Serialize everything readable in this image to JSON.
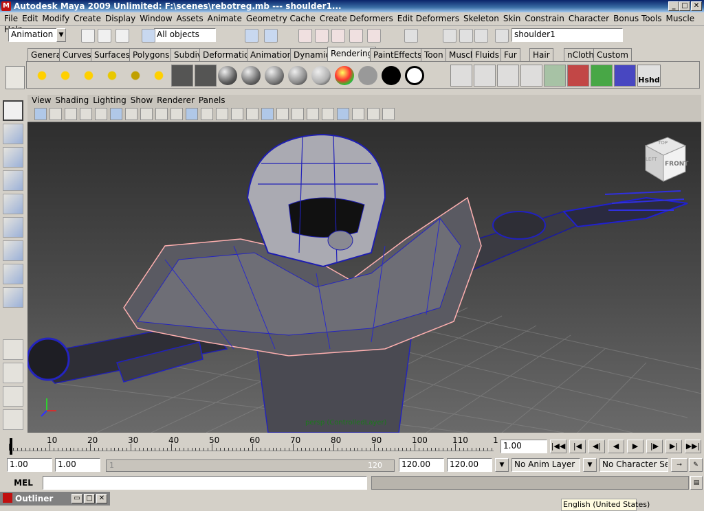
{
  "window": {
    "title": "Autodesk Maya 2009 Unlimited: F:\\scenes\\rebotreg.mb   ---   shoulder1...",
    "minimize": "_",
    "maximize": "□",
    "close": "✕"
  },
  "menus": [
    "File",
    "Edit",
    "Modify",
    "Create",
    "Display",
    "Window",
    "Assets",
    "Animate",
    "Geometry Cache",
    "Create Deformers",
    "Edit Deformers",
    "Skeleton",
    "Skin",
    "Constrain",
    "Character",
    "Bonus Tools",
    "Muscle",
    "Help"
  ],
  "statusline": {
    "menu_set": "Animation",
    "selection_mask": "All objects",
    "name_field": "shoulder1"
  },
  "shelf_tabs": [
    "General",
    "Curves",
    "Surfaces",
    "Polygons",
    "Subdivs",
    "Deformation",
    "Animation",
    "Dynamics",
    "Rendering",
    "PaintEffects",
    "Toon",
    "Muscle",
    "Fluids",
    "Fur",
    "Hair",
    "nCloth",
    "Custom"
  ],
  "active_shelf": "Rendering",
  "shelf_icons": [
    "ambient-light-icon",
    "directional-light-icon",
    "point-light-icon",
    "spot-light-icon",
    "area-light-icon",
    "volume-light-icon",
    "camera-icon",
    "camera-aim-icon",
    "lambert-sphere-icon",
    "blinn-sphere-icon",
    "phong-sphere-icon",
    "phonge-sphere-icon",
    "anisotropic-sphere-icon",
    "ramp-sphere-icon",
    "gray-swatch-icon",
    "black-swatch-icon",
    "white-ring-icon",
    "render-icon",
    "ipr-render-icon",
    "render-settings-icon",
    "hypershade-icon",
    "light-link-icon",
    "break-light-link-icon",
    "make-light-link-icon",
    "paint-brush-icon"
  ],
  "shelf_label_hshd": "Hshd",
  "panel_menus": [
    "View",
    "Shading",
    "Lighting",
    "Show",
    "Renderer",
    "Panels"
  ],
  "viewport": {
    "viewcube_top": "TOP",
    "viewcube_front": "FRONT",
    "viewcube_left": "LEFT",
    "camera_label": "persp (ControlledLayer)"
  },
  "timeline": {
    "ticks": [
      "10",
      "20",
      "30",
      "40",
      "50",
      "60",
      "70",
      "80",
      "90",
      "100",
      "110",
      "1"
    ],
    "current_frame": "1.00"
  },
  "range": {
    "start_time": "1.00",
    "playback_start": "1.00",
    "slider_start": "1",
    "slider_end": "120",
    "playback_end": "120.00",
    "end_time": "120.00",
    "anim_layer": "No Anim Layer",
    "character_set": "No Character Set"
  },
  "playback": [
    "|◀◀",
    "|◀",
    "◀|",
    "◀",
    "▶",
    "|▶",
    "▶|",
    "▶▶|"
  ],
  "cmdline": {
    "label": "MEL"
  },
  "outliner": {
    "title": "Outliner"
  },
  "language_bar": "English (United States)"
}
